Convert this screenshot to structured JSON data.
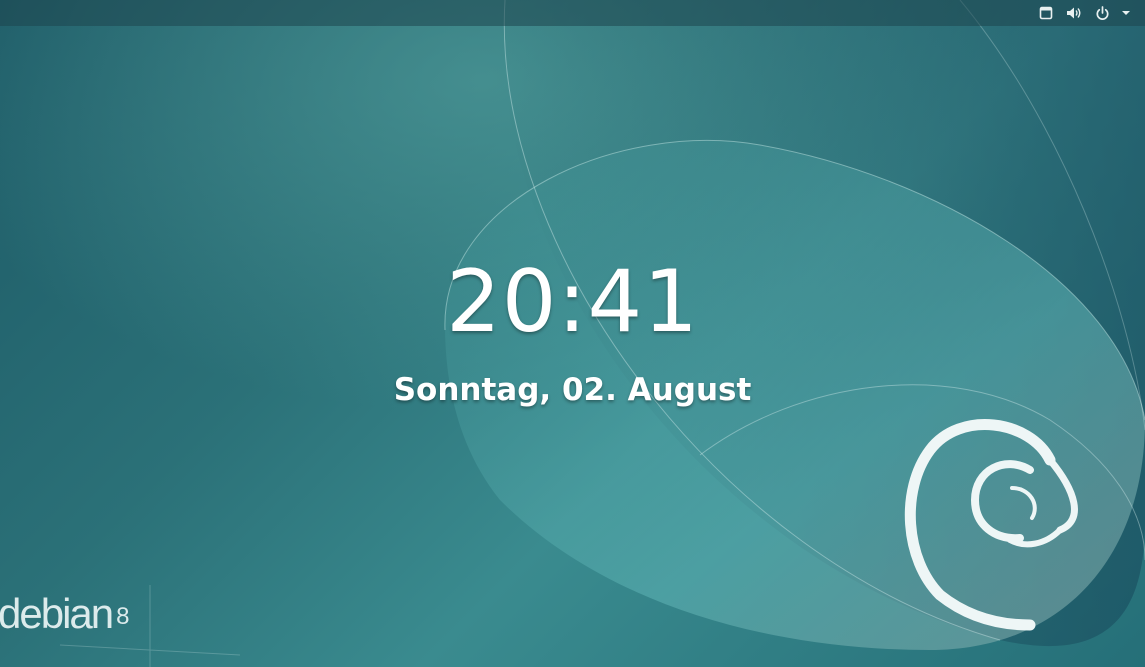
{
  "lockscreen": {
    "time": "20:41",
    "date": "Sonntag, 02. August"
  },
  "topbar": {
    "icons": [
      "window-icon",
      "volume-icon",
      "power-icon",
      "chevron-down-icon"
    ]
  },
  "wallpaper": {
    "brand_name": "debian",
    "brand_version": "8",
    "colors": {
      "background": "#2b7178",
      "accent": "#3fb0b3",
      "text": "#ffffff"
    }
  }
}
